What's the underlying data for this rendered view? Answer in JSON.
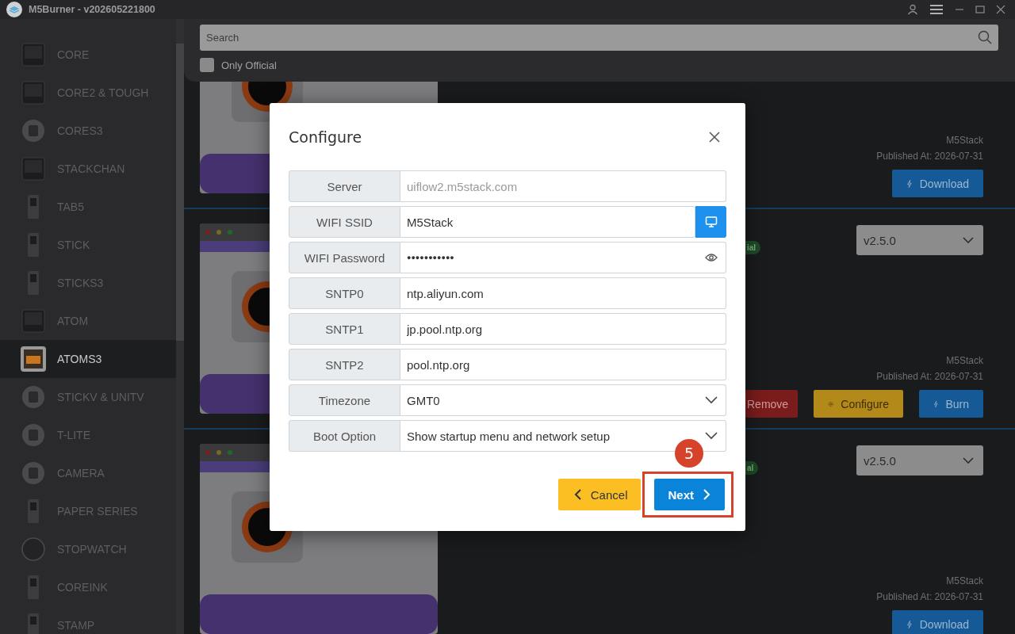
{
  "window": {
    "title": "M5Burner - v202605221800"
  },
  "sidebar": {
    "items": [
      {
        "label": "CORE",
        "kind": "core",
        "selected": false
      },
      {
        "label": "CORE2 & TOUGH",
        "kind": "core",
        "selected": false
      },
      {
        "label": "CORES3",
        "kind": "round",
        "selected": false
      },
      {
        "label": "STACKCHAN",
        "kind": "core",
        "selected": false
      },
      {
        "label": "TAB5",
        "kind": "tall",
        "selected": false
      },
      {
        "label": "STICK",
        "kind": "tall",
        "selected": false
      },
      {
        "label": "STICKS3",
        "kind": "tall",
        "selected": false
      },
      {
        "label": "ATOM",
        "kind": "core",
        "selected": false
      },
      {
        "label": "ATOMS3",
        "kind": "atom",
        "selected": true
      },
      {
        "label": "STICKV & UNITV",
        "kind": "round",
        "selected": false
      },
      {
        "label": "T-LITE",
        "kind": "round",
        "selected": false
      },
      {
        "label": "CAMERA",
        "kind": "round",
        "selected": false
      },
      {
        "label": "PAPER SERIES",
        "kind": "tall",
        "selected": false
      },
      {
        "label": "STOPWATCH",
        "kind": "dial",
        "selected": false
      },
      {
        "label": "COREINK",
        "kind": "tall",
        "selected": false
      },
      {
        "label": "STAMP",
        "kind": "tall",
        "selected": false
      }
    ]
  },
  "search": {
    "placeholder": "Search",
    "only_official": {
      "label": "Only Official",
      "checked": false
    }
  },
  "cards": [
    {
      "kind": "picture",
      "author": "M5Stack",
      "published": "Published At: 2026-07-31",
      "actions": [
        {
          "label": "Download",
          "kind": "download"
        }
      ]
    },
    {
      "kind": "picture",
      "badge": "ial",
      "version": "v2.5.0",
      "author": "M5Stack",
      "published": "Published At: 2026-07-31",
      "actions": [
        {
          "label": "Remove",
          "kind": "remove"
        },
        {
          "label": "Configure",
          "kind": "configure"
        },
        {
          "label": "Burn",
          "kind": "burn"
        }
      ]
    },
    {
      "kind": "picture",
      "badge": "al",
      "version": "v2.5.0",
      "author": "M5Stack",
      "published": "Published At: 2026-07-31",
      "actions": [
        {
          "label": "Download",
          "kind": "download"
        }
      ]
    }
  ],
  "dialog": {
    "title": "Configure",
    "fields": [
      {
        "label": "Server",
        "kind": "text",
        "placeholder": "uiflow2.m5stack.com"
      },
      {
        "label": "WIFI SSID",
        "kind": "scan",
        "value": "M5Stack"
      },
      {
        "label": "WIFI Password",
        "kind": "password",
        "value": "●●●●●●●●●●●"
      },
      {
        "label": "SNTP0",
        "kind": "text",
        "value": "ntp.aliyun.com"
      },
      {
        "label": "SNTP1",
        "kind": "text",
        "value": "jp.pool.ntp.org"
      },
      {
        "label": "SNTP2",
        "kind": "text",
        "value": "pool.ntp.org"
      },
      {
        "label": "Timezone",
        "kind": "select",
        "value": "GMT0"
      },
      {
        "label": "Boot Option",
        "kind": "select",
        "value": "Show startup menu and network setup"
      }
    ],
    "buttons": [
      {
        "label": "Cancel",
        "kind": "back"
      },
      {
        "label": "Next",
        "kind": "next",
        "highlighted": true
      }
    ],
    "step_badge": "5"
  }
}
